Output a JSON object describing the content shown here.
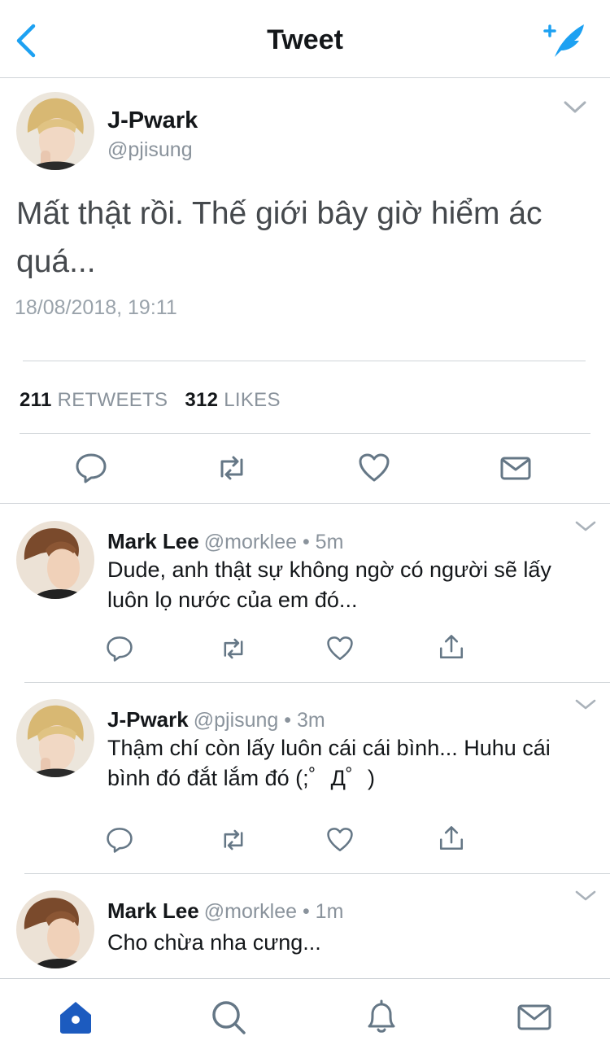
{
  "header": {
    "title": "Tweet"
  },
  "main_tweet": {
    "name": "J-Pwark",
    "handle": "@pjisung",
    "text": "Mất thật rồi. Thế giới bây giờ hiểm ác quá...",
    "timestamp": "18/08/2018, 19:11",
    "retweets_count": "211",
    "retweets_label": "RETWEETS",
    "likes_count": "312",
    "likes_label": "LIKES"
  },
  "replies": [
    {
      "name": "Mark Lee",
      "handle": "@morklee",
      "time": "• 5m",
      "text": "Dude, anh thật sự không ngờ có người sẽ lấy luôn lọ nước của em đó..."
    },
    {
      "name": "J-Pwark",
      "handle": "@pjisung",
      "time": "• 3m",
      "text": "Thậm chí còn lấy luôn cái cái bình... Huhu cái bình đó đắt lắm đó (;゜Д゜)"
    },
    {
      "name": "Mark Lee",
      "handle": "@morklee",
      "time": "• 1m",
      "text": "Cho chừa nha cưng..."
    }
  ],
  "icons": {
    "back": "chevron-left-icon",
    "compose": "compose-feather-icon",
    "reply": "reply-bubble-icon",
    "retweet": "retweet-icon",
    "like": "heart-icon",
    "dm": "envelope-icon",
    "share": "share-icon",
    "home": "home-icon",
    "search": "search-icon",
    "notifications": "bell-icon",
    "messages": "envelope-icon"
  },
  "colors": {
    "accent": "#1da1f2",
    "home_active": "#1c5bbf",
    "icon_gray": "#657786",
    "text_gray": "#8a939c"
  }
}
